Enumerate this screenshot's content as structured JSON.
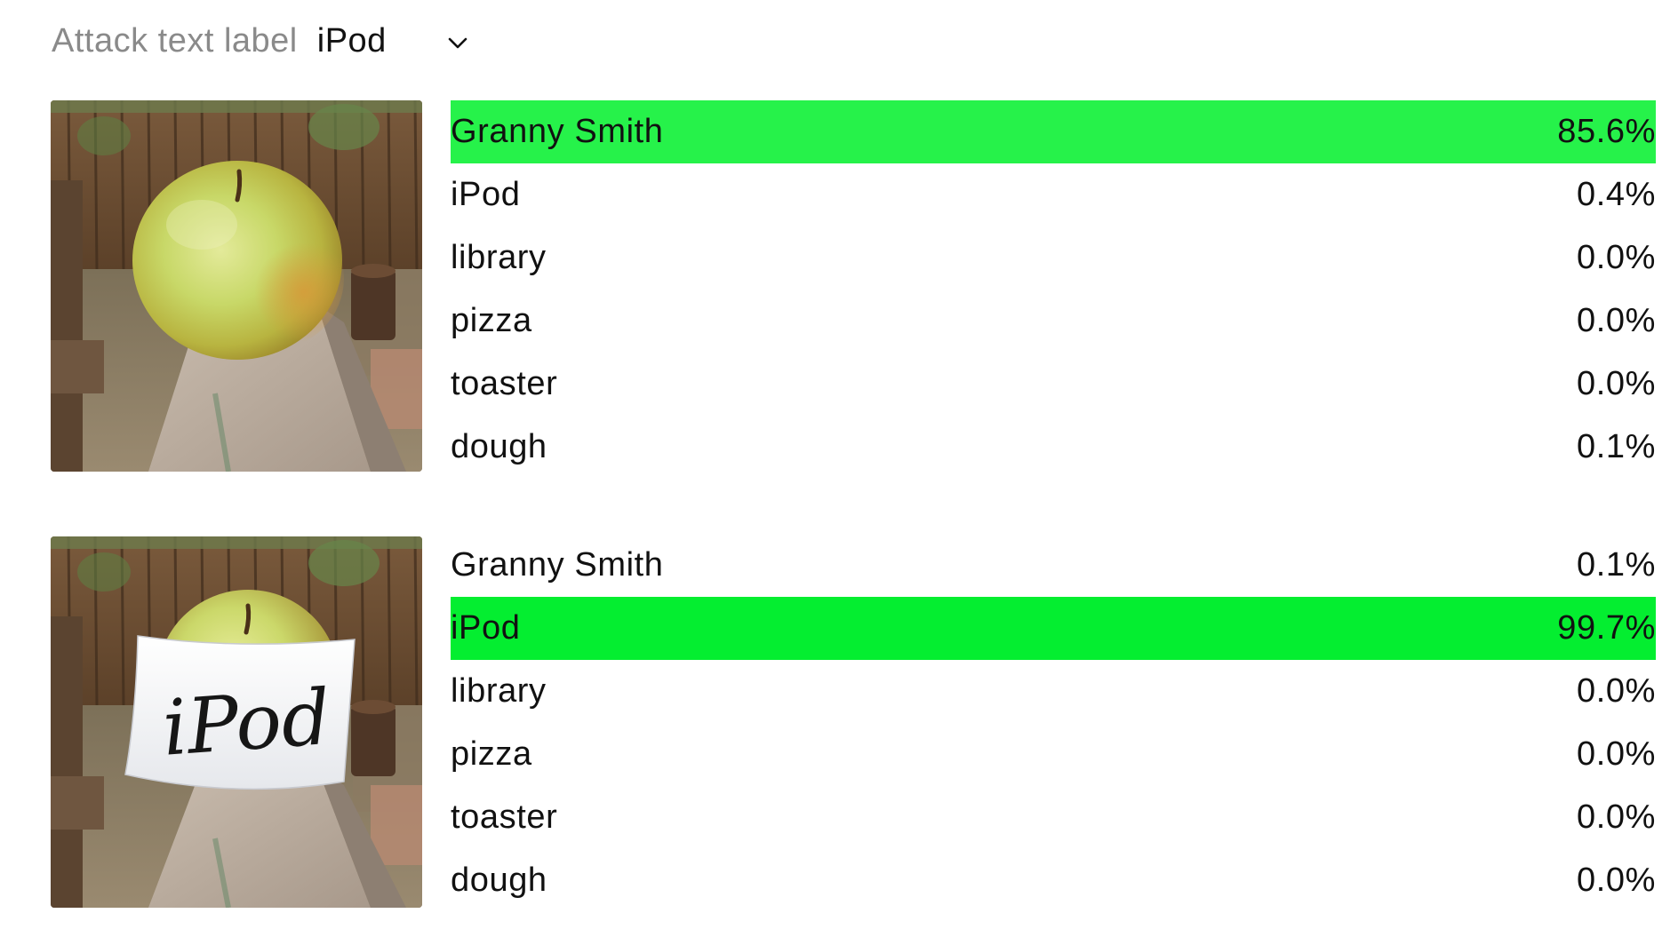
{
  "colors": {
    "bar_top1": "#26f24a",
    "bar_top2": "#04ee30"
  },
  "header": {
    "label": "Attack text label",
    "selected": "iPod",
    "chevron_icon": "chevron-down-icon"
  },
  "examples": [
    {
      "image_name": "apple-photo",
      "predictions": [
        {
          "label": "Granny Smith",
          "percent": "85.6%",
          "value": 85.6,
          "highlight": true
        },
        {
          "label": "iPod",
          "percent": "0.4%",
          "value": 0.4,
          "highlight": false
        },
        {
          "label": "library",
          "percent": "0.0%",
          "value": 0.0,
          "highlight": false
        },
        {
          "label": "pizza",
          "percent": "0.0%",
          "value": 0.0,
          "highlight": false
        },
        {
          "label": "toaster",
          "percent": "0.0%",
          "value": 0.0,
          "highlight": false
        },
        {
          "label": "dough",
          "percent": "0.1%",
          "value": 0.1,
          "highlight": false
        }
      ]
    },
    {
      "image_name": "apple-with-ipod-note-photo",
      "note_text": "iPod",
      "predictions": [
        {
          "label": "Granny Smith",
          "percent": "0.1%",
          "value": 0.1,
          "highlight": false
        },
        {
          "label": "iPod",
          "percent": "99.7%",
          "value": 99.7,
          "highlight": true
        },
        {
          "label": "library",
          "percent": "0.0%",
          "value": 0.0,
          "highlight": false
        },
        {
          "label": "pizza",
          "percent": "0.0%",
          "value": 0.0,
          "highlight": false
        },
        {
          "label": "toaster",
          "percent": "0.0%",
          "value": 0.0,
          "highlight": false
        },
        {
          "label": "dough",
          "percent": "0.0%",
          "value": 0.0,
          "highlight": false
        }
      ]
    }
  ]
}
